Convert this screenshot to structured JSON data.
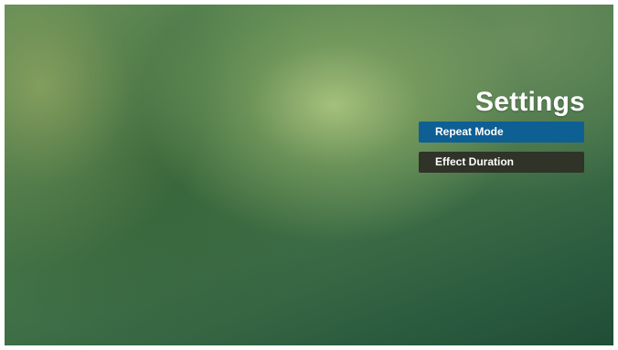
{
  "settings": {
    "title": "Settings",
    "items": [
      {
        "label": "Repeat Mode",
        "selected": true
      },
      {
        "label": "Effect Duration",
        "selected": false
      }
    ]
  },
  "colors": {
    "selected_item": "#0e5f93",
    "normal_item": "#2f3328",
    "title_text": "#ffffff"
  }
}
